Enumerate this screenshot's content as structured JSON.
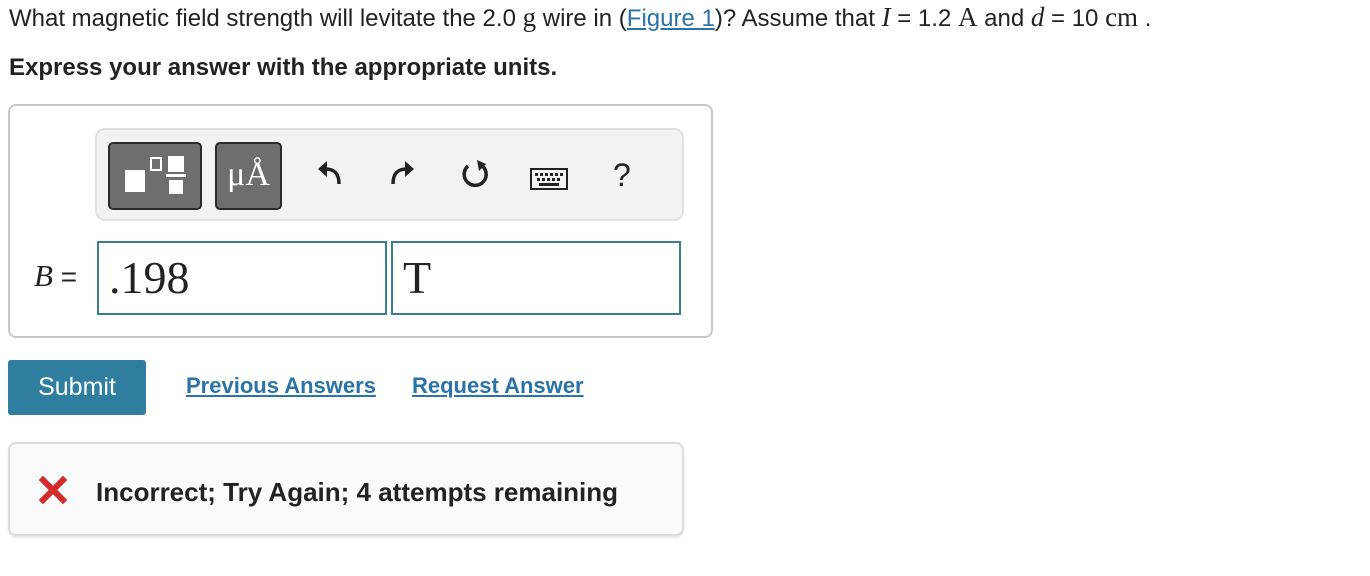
{
  "question": {
    "text1": "What magnetic field strength will levitate the 2.0 ",
    "mass_unit": "g",
    "text2": " wire in (",
    "figure_link": "Figure 1",
    "text3": ")? Assume that ",
    "var_I": "I",
    "text4": " = 1.2 ",
    "current_unit": "A",
    "text5": " and ",
    "var_d": "d",
    "text6": " = 10 ",
    "length_unit": "cm",
    "text7": " ."
  },
  "instruction": "Express your answer with the appropriate units.",
  "toolbar": {
    "templates_icon": "templates-icon",
    "units_label": "μÅ",
    "undo_icon": "undo-icon",
    "redo_icon": "redo-icon",
    "reset_icon": "reset-icon",
    "keyboard_icon": "keyboard-icon",
    "help_label": "?"
  },
  "answer": {
    "variable": "B",
    "equals": "=",
    "value": ".198",
    "unit": "T"
  },
  "actions": {
    "submit": "Submit",
    "previous_answers": "Previous Answers",
    "request_answer": "Request Answer"
  },
  "feedback": {
    "icon": "x-icon",
    "message": "Incorrect; Try Again; 4 attempts remaining",
    "icon_color": "#d42a2a"
  },
  "colors": {
    "accent": "#2f7ea0",
    "link": "#2a73a8",
    "field_border": "#3a7f93"
  }
}
